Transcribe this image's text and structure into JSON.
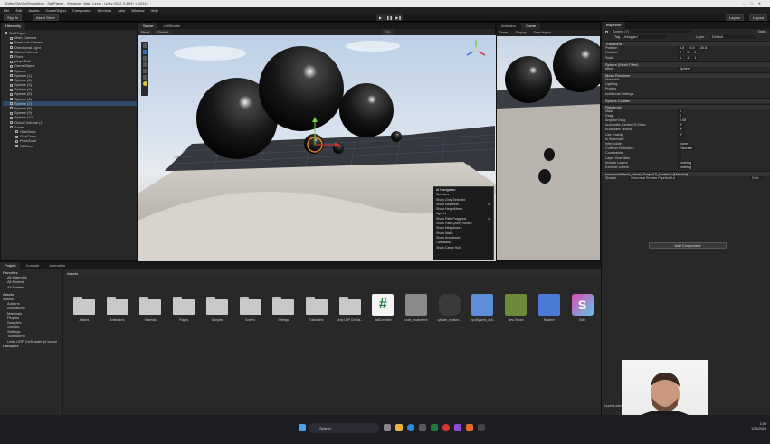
{
  "window": {
    "title": "EditorCityVoxSimulation - SaltPlayer - Windows, Mac, Linux - Unity 2022.3.39f1* <DX11>",
    "controls": [
      "–",
      "□",
      "✕"
    ]
  },
  "menu": [
    "File",
    "Edit",
    "Assets",
    "GameObject",
    "Component",
    "Services",
    "Jobs",
    "Window",
    "Help"
  ],
  "toolbar": {
    "account": "Sign in",
    "cloud": "Asset Store",
    "layers": "Layers",
    "layout": "Layout",
    "play": "▶",
    "pause": "❚❚",
    "step": "▶❚"
  },
  "hierarchy": {
    "tab": "Hierarchy",
    "items": [
      {
        "label": "SaltPlayer*",
        "indent": 0
      },
      {
        "label": "Main Camera",
        "indent": 1
      },
      {
        "label": "FreeLook Camera",
        "indent": 1
      },
      {
        "label": "Directional Light",
        "indent": 1
      },
      {
        "label": "Global Volume",
        "indent": 1
      },
      {
        "label": "Floor",
        "indent": 1
      },
      {
        "label": "playerBall",
        "indent": 1
      },
      {
        "label": "GameObject",
        "indent": 1
      },
      {
        "label": "Sphere",
        "indent": 1
      },
      {
        "label": "Sphere (1)",
        "indent": 1
      },
      {
        "label": "Sphere (2)",
        "indent": 1
      },
      {
        "label": "Sphere (3)",
        "indent": 1
      },
      {
        "label": "Sphere (4)",
        "indent": 1
      },
      {
        "label": "Sphere (5)",
        "indent": 1
      },
      {
        "label": "Sphere (6)",
        "indent": 1
      },
      {
        "label": "Sphere (7)",
        "indent": 1,
        "selected": true
      },
      {
        "label": "Sphere (8)",
        "indent": 1
      },
      {
        "label": "Sphere (9)",
        "indent": 1
      },
      {
        "label": "Sphere (10)",
        "indent": 1
      },
      {
        "label": "Global Volume (1)",
        "indent": 1
      },
      {
        "label": "Zones",
        "indent": 1
      },
      {
        "label": "StartZone",
        "indent": 2
      },
      {
        "label": "GoalZone",
        "indent": 2
      },
      {
        "label": "PushZone",
        "indent": 2
      },
      {
        "label": "KillZone",
        "indent": 2
      }
    ]
  },
  "scene": {
    "tabs": [
      "Scene",
      "cellShader"
    ],
    "tools": [
      "Pivot",
      "Global",
      "2D",
      "Persp"
    ],
    "overlay_title": "AI Navigation",
    "overlay_items": [
      {
        "label": "Surfaces",
        "checked": false
      },
      {
        "label": "Show Only Selected",
        "checked": false
      },
      {
        "label": "Show NavMesh",
        "checked": true
      },
      {
        "label": "Show HeightMesh",
        "checked": false
      },
      {
        "label": "Agents",
        "checked": false
      },
      {
        "label": "Show Path Polygons",
        "checked": true
      },
      {
        "label": "Show Path Query Nodes",
        "checked": false
      },
      {
        "label": "Show Neighbours",
        "checked": false
      },
      {
        "label": "Show Walls",
        "checked": false
      },
      {
        "label": "Show Avoidance",
        "checked": false
      },
      {
        "label": "Obstacles",
        "checked": false
      },
      {
        "label": "Show Carve Hull",
        "checked": false
      }
    ]
  },
  "game": {
    "tabs": [
      "Animator",
      "Game"
    ],
    "display": "Display 1",
    "aspect": "Free Aspect",
    "mode": "Game"
  },
  "inspector": {
    "tab": "Inspector",
    "name": "Sphere (7)",
    "static": "Static",
    "tag": "Untagged",
    "layer": "Default",
    "transform": {
      "title": "Transform",
      "position": [
        "5.8",
        "0.5",
        "28.81"
      ],
      "rotation": [
        "0",
        "0",
        "0"
      ],
      "scale": [
        "1",
        "1",
        "1"
      ]
    },
    "mesh_filter": {
      "title": "Sphere (Mesh Filter)",
      "mesh": "Sphere"
    },
    "mesh_renderer": {
      "title": "Mesh Renderer",
      "rows": [
        "Materials",
        "Lighting",
        "Probes",
        "Additional Settings"
      ]
    },
    "sphere_collider": {
      "title": "Sphere Collider"
    },
    "rigidbody": {
      "title": "Rigidbody",
      "rows": [
        {
          "label": "Mass",
          "value": "1"
        },
        {
          "label": "Drag",
          "value": "0"
        },
        {
          "label": "Angular Drag",
          "value": "0.05"
        },
        {
          "label": "Automatic Center Of Mass",
          "value": "✔"
        },
        {
          "label": "Automatic Tensor",
          "value": "✔"
        },
        {
          "label": "Use Gravity",
          "value": "✔"
        },
        {
          "label": "Is Kinematic",
          "value": ""
        },
        {
          "label": "Interpolate",
          "value": "None"
        },
        {
          "label": "Collision Detection",
          "value": "Discrete"
        },
        {
          "label": "Constraints",
          "value": ""
        },
        {
          "label": "Layer Overrides",
          "value": ""
        },
        {
          "label": "Include Layers",
          "value": "Nothing"
        },
        {
          "label": "Exclude Layers",
          "value": "Nothing"
        }
      ]
    },
    "material": {
      "title": "InstancedMesh_Voxel_Graph15_Material (Material)",
      "shader_label": "Shader",
      "shader": "Universal Render Pipeline/Lit",
      "edit": "Edit..."
    },
    "add_component": "Add Component",
    "asset_labels": "Asset Labels"
  },
  "project": {
    "tabs": [
      "Project",
      "Console",
      "Animation"
    ],
    "favorites": {
      "title": "Favorites",
      "items": [
        "All Materials",
        "All Models",
        "All Prefabs"
      ]
    },
    "assets_tree": {
      "title": "Assets",
      "items": [
        "Assets",
        "Addons",
        "Animations",
        "Materials",
        "Plugins",
        "Samples",
        "Scenes",
        "Settings",
        "TutorialInfo",
        "Unity URP CelShader (4 visual"
      ]
    },
    "packages": "Packages",
    "breadcrumb": "Assets",
    "assets": [
      {
        "label": "Addons",
        "type": "folder"
      },
      {
        "label": "Animations",
        "type": "folder"
      },
      {
        "label": "Materials",
        "type": "folder"
      },
      {
        "label": "Plugins",
        "type": "folder"
      },
      {
        "label": "Samples",
        "type": "folder"
      },
      {
        "label": "Scenes",
        "type": "folder"
      },
      {
        "label": "Settings",
        "type": "folder"
      },
      {
        "label": "TutorialInfo",
        "type": "folder"
      },
      {
        "label": "Unity URP CelSha...",
        "type": "folder"
      },
      {
        "label": "BallController",
        "type": "script"
      },
      {
        "label": "cube_recalcmesh",
        "type": "mesh"
      },
      {
        "label": "cylinder_recalcm...",
        "type": "mesh-dark"
      },
      {
        "label": "InputSystem_Acti...",
        "type": "input"
      },
      {
        "label": "New Terrain",
        "type": "terrain"
      },
      {
        "label": "Readme",
        "type": "readme"
      },
      {
        "label": "Slots",
        "type": "shader"
      }
    ]
  },
  "taskbar": {
    "search_placeholder": "Search",
    "time": "1:08",
    "date": "1/23/2025"
  }
}
